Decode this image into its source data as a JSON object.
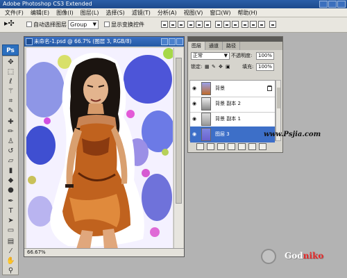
{
  "window": {
    "title": "Adobe Photoshop CS3 Extended"
  },
  "menu": [
    "文件(F)",
    "编辑(E)",
    "图像(I)",
    "图层(L)",
    "选择(S)",
    "滤镜(T)",
    "分析(A)",
    "视图(V)",
    "窗口(W)",
    "帮助(H)"
  ],
  "options": {
    "auto_select_label": "自动选择图层",
    "auto_select_value": "Group",
    "show_transform_label": "显示变换控件"
  },
  "app_logo": "Ps",
  "document": {
    "title": "未命名-1.psd @ 66.7% (图层 3, RGB/8)",
    "zoom": "66.67%"
  },
  "layers_panel": {
    "tabs": [
      "图层",
      "通道",
      "路径"
    ],
    "blend_mode": "正常",
    "opacity_label": "不透明度:",
    "opacity_value": "100%",
    "lock_label": "锁定:",
    "fill_label": "填充:",
    "fill_value": "100%",
    "layers": [
      {
        "name": "背景",
        "locked": true,
        "selected": false
      },
      {
        "name": "背景 副本 2",
        "locked": false,
        "selected": false
      },
      {
        "name": "背景 副本 1",
        "locked": false,
        "selected": false
      },
      {
        "name": "图层 3",
        "locked": false,
        "selected": true
      }
    ]
  },
  "watermark": "www.Psjia.com",
  "brand": {
    "part1": "God",
    "part2": "niko"
  },
  "colors": {
    "selected_layer": "#3d6fc8",
    "titlebar": "#2459a3"
  }
}
